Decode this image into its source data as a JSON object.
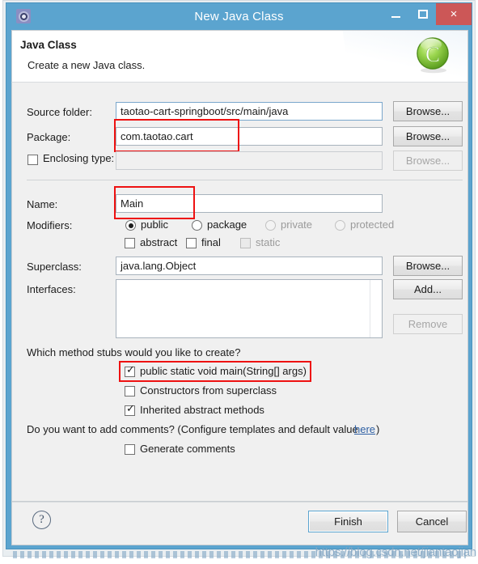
{
  "window": {
    "title": "New Java Class",
    "icon": "gear-icon",
    "minimize_label": "–",
    "maximize_label": "□",
    "close_label": "×"
  },
  "header": {
    "title": "Java Class",
    "subtitle": "Create a new Java class.",
    "logo": "java-class-green-c-icon"
  },
  "form": {
    "source_folder": {
      "label": "Source folder:",
      "value": "taotao-cart-springboot/src/main/java",
      "browse": "Browse..."
    },
    "package": {
      "label": "Package:",
      "value": "com.taotao.cart",
      "browse": "Browse...",
      "highlighted": true
    },
    "enclosing_type": {
      "label": "Enclosing type:",
      "value": "",
      "checked": false,
      "browse": "Browse...",
      "disabled": true
    },
    "name": {
      "label": "Name:",
      "value": "Main",
      "highlighted": true
    },
    "modifiers": {
      "label": "Modifiers:",
      "radios": [
        {
          "label": "public",
          "checked": true,
          "disabled": false
        },
        {
          "label": "package",
          "checked": false,
          "disabled": false
        },
        {
          "label": "private",
          "checked": false,
          "disabled": true
        },
        {
          "label": "protected",
          "checked": false,
          "disabled": true
        }
      ],
      "checkboxes": [
        {
          "label": "abstract",
          "checked": false,
          "disabled": false
        },
        {
          "label": "final",
          "checked": false,
          "disabled": false
        },
        {
          "label": "static",
          "checked": false,
          "disabled": true
        }
      ]
    },
    "superclass": {
      "label": "Superclass:",
      "value": "java.lang.Object",
      "browse": "Browse..."
    },
    "interfaces": {
      "label": "Interfaces:",
      "items": [],
      "add": "Add...",
      "remove": "Remove",
      "remove_disabled": true
    }
  },
  "stubs": {
    "question": "Which method stubs would you like to create?",
    "options": [
      {
        "label": "public static void main(String[] args)",
        "checked": true,
        "highlighted": true
      },
      {
        "label": "Constructors from superclass",
        "checked": false,
        "highlighted": false
      },
      {
        "label": "Inherited abstract methods",
        "checked": true,
        "highlighted": false
      }
    ]
  },
  "comments": {
    "question_prefix": "Do you want to add comments? (Configure templates and default value ",
    "link": "here",
    "question_suffix": ")",
    "checkbox": {
      "label": "Generate comments",
      "checked": false
    }
  },
  "footer": {
    "help_icon": "question-mark-icon",
    "finish": "Finish",
    "cancel": "Cancel"
  },
  "watermark": {
    "text": "https://blog.csdn.net/jiantaojian"
  },
  "colors": {
    "titlebar": "#5ba4cf",
    "close_button": "#cc5757",
    "panel": "#f0f0f0",
    "annotation": "#ee1111",
    "link": "#2e5fa3",
    "logo_green": "#7ec943"
  }
}
